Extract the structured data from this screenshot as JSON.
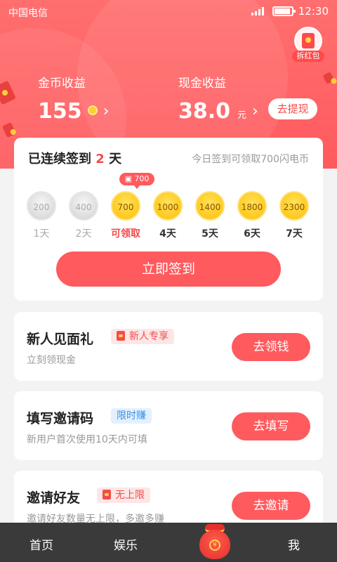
{
  "status_bar": {
    "carrier": "中国电信",
    "time": "12:30"
  },
  "red_packet": {
    "label": "拆红包"
  },
  "earnings": {
    "coins": {
      "title": "金币收益",
      "value": "155"
    },
    "cash": {
      "title": "现金收益",
      "value": "38.0",
      "unit": "元"
    },
    "withdraw_label": "去提现"
  },
  "signin": {
    "prefix": "已连续签到",
    "days": "2",
    "suffix": "天",
    "hint": "今日签到可领取700闪电币",
    "today_badge": "700",
    "items": [
      {
        "amount": "200",
        "label": "1天"
      },
      {
        "amount": "400",
        "label": "2天"
      },
      {
        "amount": "700",
        "label": "可领取"
      },
      {
        "amount": "1000",
        "label": "4天"
      },
      {
        "amount": "1400",
        "label": "5天"
      },
      {
        "amount": "1800",
        "label": "6天"
      },
      {
        "amount": "2300",
        "label": "7天"
      }
    ],
    "button": "立即签到"
  },
  "tasks": [
    {
      "title": "新人见面礼",
      "tag": "新人专享",
      "subtitle": "立刻领现金",
      "button": "去领钱"
    },
    {
      "title": "填写邀请码",
      "tag": "限时赚",
      "subtitle": "新用户首次使用10天内可填",
      "button": "去填写"
    },
    {
      "title": "邀请好友",
      "tag": "无上限",
      "subtitle": "邀请好友数量无上限，多邀多赚",
      "button": "去邀请"
    }
  ],
  "tabbar": {
    "home": "首页",
    "entertainment": "娱乐",
    "me": "我"
  },
  "colors": {
    "accent": "#ff5a5e",
    "gold": "#ffc91f"
  }
}
